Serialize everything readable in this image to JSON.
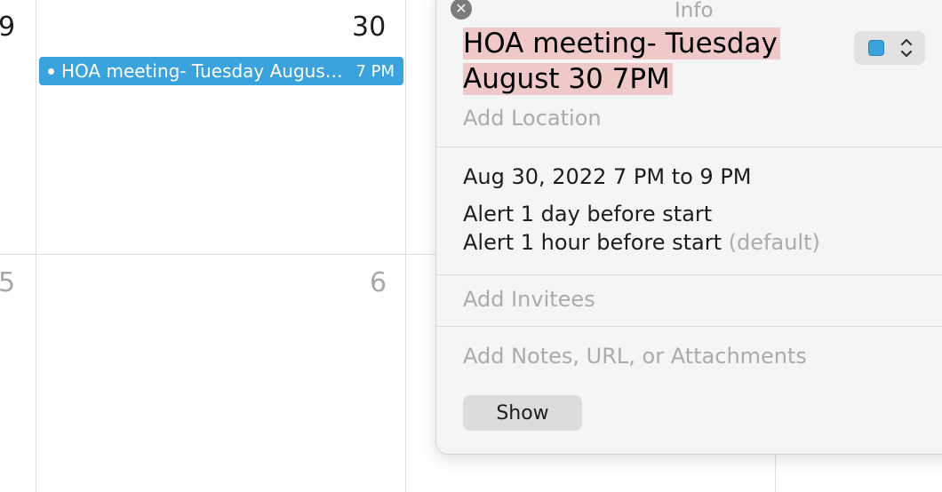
{
  "calendar": {
    "days": [
      {
        "label": "9"
      },
      {
        "label": "30"
      },
      {
        "label": "5"
      },
      {
        "label": "6"
      }
    ],
    "event": {
      "title": "HOA meeting- Tuesday August 30 7PM",
      "time": "7 PM",
      "color": "#3aa3dd"
    }
  },
  "popover": {
    "header": "Info",
    "event_name_line1": "HOA meeting- Tuesday",
    "event_name_line2": "August 30 7PM",
    "location_placeholder": "Add Location",
    "date_time": "Aug 30, 2022  7 PM to 9 PM",
    "alert_1": "Alert 1 day before start",
    "alert_2": "Alert 1 hour before start",
    "alert_2_note": "(default)",
    "invitees_placeholder": "Add Invitees",
    "notes_placeholder": "Add Notes, URL, or Attachments",
    "show_label": "Show",
    "calendar_color": "#3aa3dd",
    "highlight_color": "#efc8c8"
  }
}
